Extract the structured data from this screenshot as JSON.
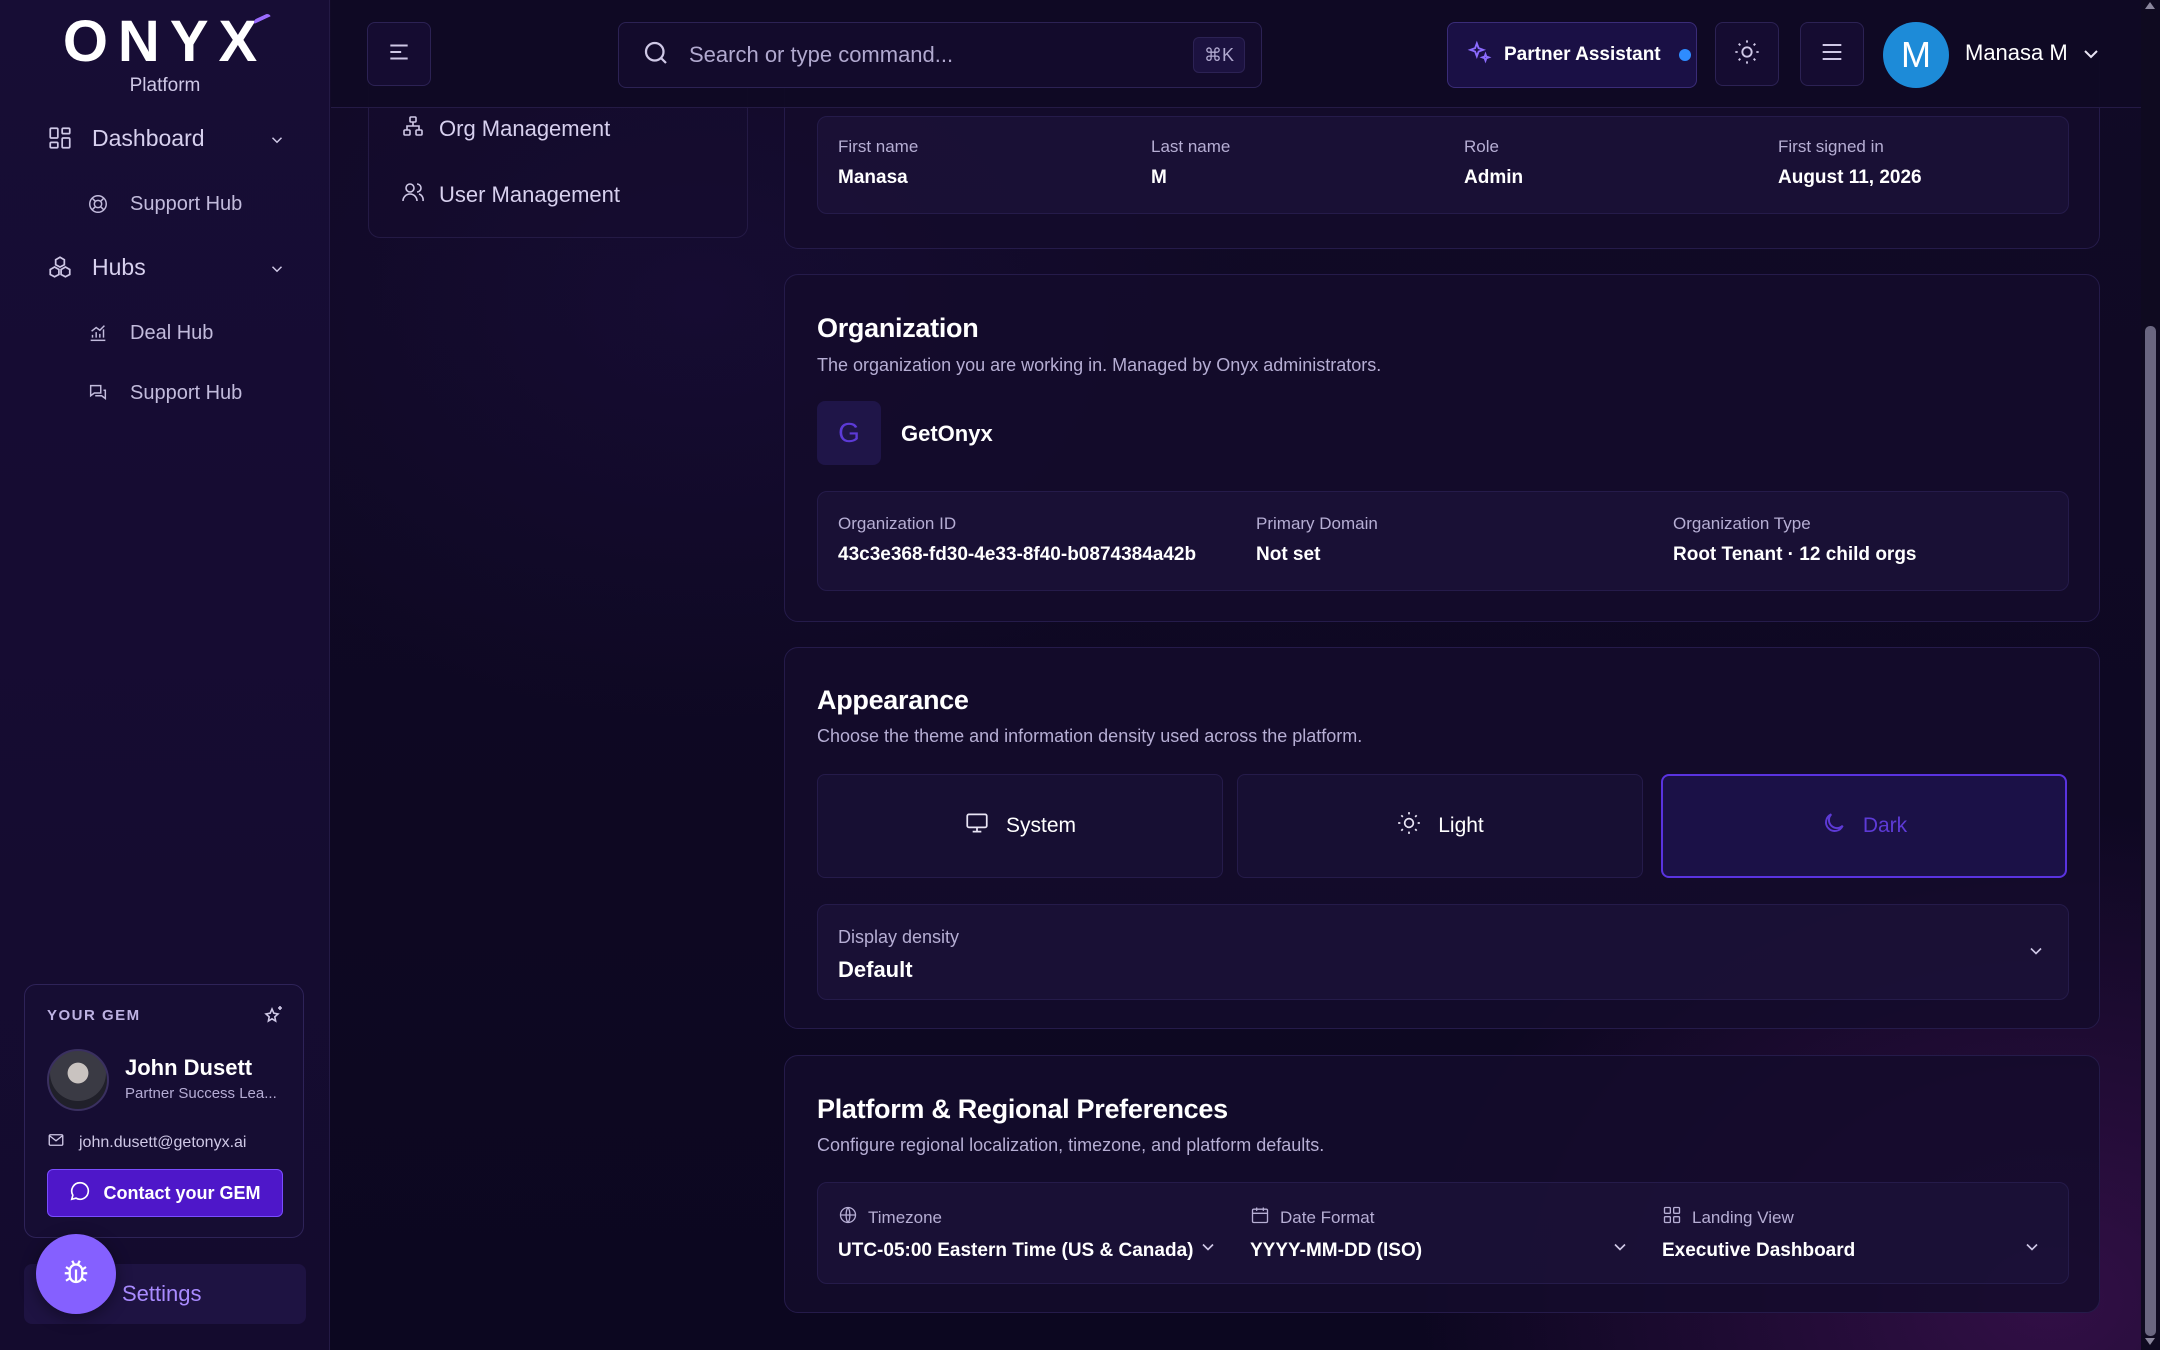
{
  "brand": {
    "name": "ONYX",
    "sub": "Platform"
  },
  "sidebar": {
    "dashboard": {
      "label": "Dashboard",
      "items": [
        "Support Hub"
      ]
    },
    "hubs": {
      "label": "Hubs",
      "items": [
        "Deal Hub",
        "Support Hub"
      ]
    },
    "gem": {
      "title": "YOUR GEM",
      "name": "John Dusett",
      "role": "Partner Success Lea...",
      "email": "john.dusett@getonyx.ai",
      "contact_label": "Contact your GEM"
    },
    "settings_label": "Settings"
  },
  "topbar": {
    "search_placeholder": "Search or type command...",
    "search_shortcut": "⌘K",
    "assistant_label": "Partner Assistant",
    "user_initial": "M",
    "user_name": "Manasa M"
  },
  "secondary_nav": {
    "items": [
      "Org Management",
      "User Management"
    ]
  },
  "profile": {
    "fields": [
      {
        "label": "First name",
        "value": "Manasa"
      },
      {
        "label": "Last name",
        "value": "M"
      },
      {
        "label": "Role",
        "value": "Admin"
      },
      {
        "label": "First signed in",
        "value": "August 11, 2026"
      }
    ]
  },
  "organization": {
    "title": "Organization",
    "description": "The organization you are working in. Managed by Onyx administrators.",
    "initial": "G",
    "name": "GetOnyx",
    "fields": [
      {
        "label": "Organization ID",
        "value": "43c3e368-fd30-4e33-8f40-b0874384a42b"
      },
      {
        "label": "Primary Domain",
        "value": "Not set"
      },
      {
        "label": "Organization Type",
        "value": "Root Tenant · 12 child orgs"
      }
    ]
  },
  "appearance": {
    "title": "Appearance",
    "description": "Choose the theme and information density used across the platform.",
    "themes": [
      "System",
      "Light",
      "Dark"
    ],
    "selected_theme": "Dark",
    "density_label": "Display density",
    "density_value": "Default"
  },
  "preferences": {
    "title": "Platform & Regional Preferences",
    "description": "Configure regional localization, timezone, and platform defaults.",
    "fields": [
      {
        "label": "Timezone",
        "value": "UTC-05:00 Eastern Time (US & Canada)"
      },
      {
        "label": "Date Format",
        "value": "YYYY-MM-DD (ISO)"
      },
      {
        "label": "Landing View",
        "value": "Executive Dashboard"
      }
    ]
  },
  "colors": {
    "accent": "#4e17c9",
    "accent_light": "#8560ff",
    "background": "#0d0820"
  }
}
